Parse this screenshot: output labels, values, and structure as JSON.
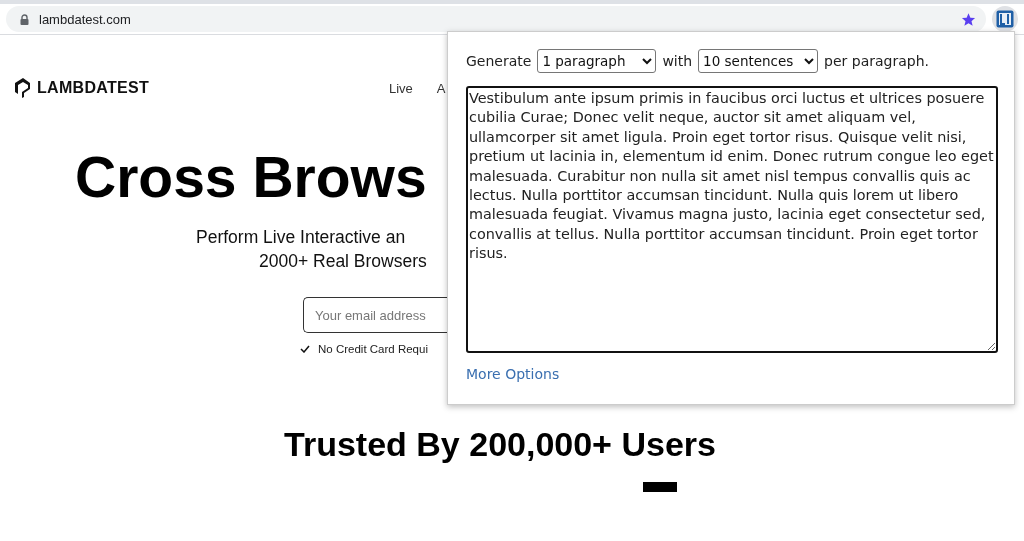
{
  "browser": {
    "url": "lambdatest.com"
  },
  "site": {
    "logo": "LAMBDATEST",
    "nav": [
      "Live",
      "A"
    ],
    "headline": "Cross Brows",
    "subtitle_lines": [
      "Perform Live Interactive an",
      "2000+ Real Browsers"
    ],
    "email": {
      "placeholder": "Your email address"
    },
    "note": "No Credit Card Requi",
    "trusted": "Trusted By 200,000+ Users"
  },
  "popup": {
    "generate_label": "Generate",
    "paragraphs": "1 paragraph",
    "with_label": "with",
    "sentences": "10 sentences",
    "per_label": "per paragraph.",
    "text": "Vestibulum ante ipsum primis in faucibus orci luctus et ultrices posuere cubilia Curae; Donec velit neque, auctor sit amet aliquam vel, ullamcorper sit amet ligula. Proin eget tortor risus. Quisque velit nisi, pretium ut lacinia in, elementum id enim. Donec rutrum congue leo eget malesuada. Curabitur non nulla sit amet nisl tempus convallis quis ac lectus. Nulla porttitor accumsan tincidunt. Nulla quis lorem ut libero malesuada feugiat. Vivamus magna justo, lacinia eget consectetur sed, convallis at tellus. Nulla porttitor accumsan tincidunt. Proin eget tortor risus.",
    "more": "More Options"
  }
}
